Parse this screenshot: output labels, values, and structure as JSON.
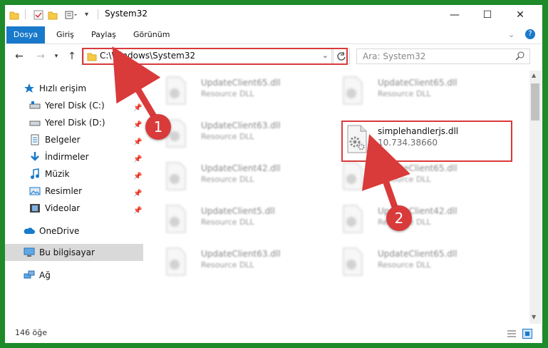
{
  "window": {
    "title": "System32"
  },
  "ribbon": {
    "tabs": [
      {
        "label": "Dosya"
      },
      {
        "label": "Giriş"
      },
      {
        "label": "Paylaş"
      },
      {
        "label": "Görünüm"
      }
    ]
  },
  "address": {
    "path": "C:\\Windows\\System32"
  },
  "search": {
    "placeholder": "Ara: System32"
  },
  "nav": {
    "items": [
      {
        "label": "Hızlı erişim"
      },
      {
        "label": "Yerel Disk (C:)"
      },
      {
        "label": "Yerel Disk (D:)"
      },
      {
        "label": "Belgeler"
      },
      {
        "label": "İndirmeler"
      },
      {
        "label": "Müzik"
      },
      {
        "label": "Resimler"
      },
      {
        "label": "Videolar"
      },
      {
        "label": "OneDrive"
      },
      {
        "label": "Bu bilgisayar"
      },
      {
        "label": "Ağ"
      }
    ]
  },
  "files": {
    "left": [
      {
        "name": "UpdateClient65.dll",
        "desc": "Resource DLL"
      },
      {
        "name": "UpdateClient63.dll",
        "desc": "Resource DLL"
      },
      {
        "name": "UpdateClient42.dll",
        "desc": "Resource DLL"
      },
      {
        "name": "UpdateClient5.dll",
        "desc": "Resource DLL"
      },
      {
        "name": "UpdateClient63.dll",
        "desc": "Resource DLL"
      }
    ],
    "right": [
      {
        "name": "UpdateClient65.dll",
        "desc": "Resource DLL"
      },
      {
        "name": "simplehandlerjs.dll",
        "desc": "10.734.38660"
      },
      {
        "name": "UpdateClient65.dll",
        "desc": "Resource DLL"
      },
      {
        "name": "UpdateClient42.dll",
        "desc": "Resource DLL"
      },
      {
        "name": "UpdateClient65.dll",
        "desc": "Resource DLL"
      }
    ]
  },
  "status": {
    "count": "146 öğe"
  },
  "annotations": {
    "step1": "1",
    "step2": "2"
  },
  "colors": {
    "accent": "#1979ca",
    "highlight": "#d93a3a",
    "frame": "#1e8a2a"
  }
}
